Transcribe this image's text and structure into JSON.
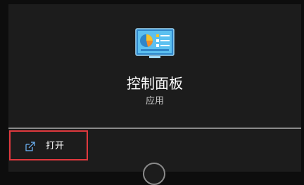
{
  "app": {
    "name": "控制面板",
    "type": "应用",
    "icon": "control-panel-icon"
  },
  "actions": [
    {
      "label": "打开",
      "icon": "open-external-icon"
    }
  ],
  "colors": {
    "background": "#1c1c1c",
    "highlight_border": "#e0393e",
    "divider": "#8a8a8a",
    "icon_blue": "#4fb3ea",
    "icon_yellow": "#f5c22b"
  }
}
